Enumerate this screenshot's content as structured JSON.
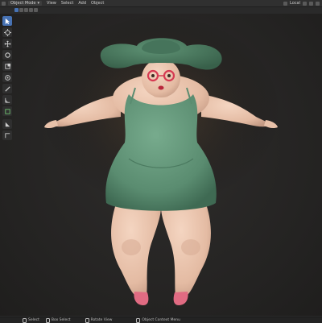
{
  "header": {
    "mode": "Object Mode",
    "menu": [
      "View",
      "Select",
      "Add",
      "Object"
    ],
    "transform_orientation": "Local"
  },
  "status": {
    "items": [
      "Select",
      "Box Select",
      "Rotate View",
      "Object Context Menu"
    ]
  },
  "colors": {
    "accent": "#4772b3",
    "dress": "#5e9476",
    "hat": "#4d7c62",
    "skin": "#e9c4ad",
    "glasses": "#d63a52",
    "shoes": "#e06b82"
  },
  "icons": [
    "cursor-icon",
    "move-icon",
    "rotate-icon",
    "scale-icon",
    "transform-icon",
    "annotate-icon",
    "measure-icon",
    "add-cube-icon"
  ]
}
